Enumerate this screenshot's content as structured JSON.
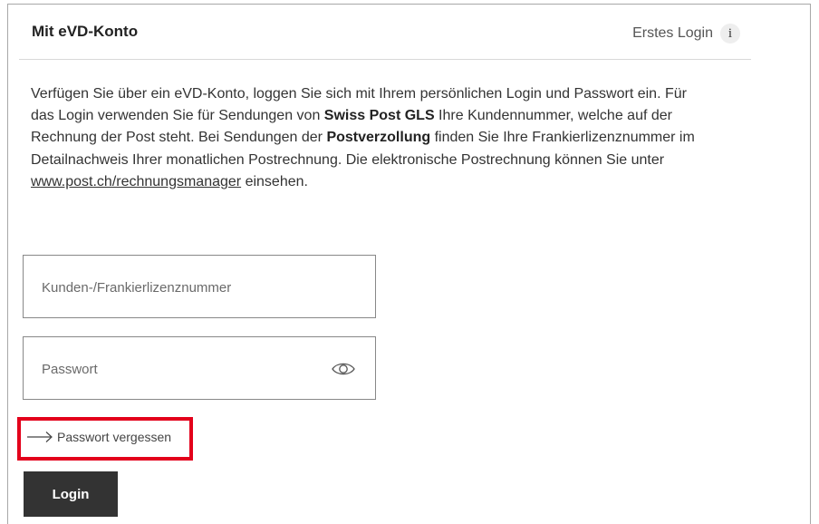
{
  "header": {
    "title": "Mit eVD-Konto",
    "first_login_label": "Erstes Login",
    "info_glyph": "i",
    "info_icon": "info-icon"
  },
  "description": {
    "part1": "Verfügen Sie über ein eVD-Konto, loggen Sie sich mit Ihrem persönlichen Login und Passwort ein. Für das Login verwenden Sie für Sendungen von ",
    "bold1": "Swiss Post GLS",
    "part2": " Ihre Kundennummer, welche auf der Rechnung der Post steht. Bei Sendungen der ",
    "bold2": "Postverzollung",
    "part3": " finden Sie Ihre Frankierlizenznummer im Detailnachweis Ihrer monatlichen Postrechnung. Die elektronische Postrechnung können Sie unter ",
    "link": "www.post.ch/rechnungsmanager",
    "part4": " einsehen."
  },
  "form": {
    "customer_number": {
      "placeholder": "Kunden-/Frankierlizenznummer",
      "value": ""
    },
    "password": {
      "placeholder": "Passwort",
      "value": "",
      "toggle_icon": "eye-icon"
    },
    "forgot_password": {
      "label": "Passwort vergessen",
      "icon": "arrow-right-icon"
    },
    "login_button": "Login"
  },
  "colors": {
    "highlight_border": "#e3001b",
    "button_bg": "#333333",
    "button_text": "#ffffff"
  }
}
